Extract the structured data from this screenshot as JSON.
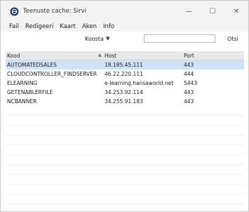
{
  "window": {
    "title": "Teenuste cache: Sirvi",
    "controls": {
      "minimize": "—",
      "maximize": "☐",
      "close": "✕"
    }
  },
  "menu": [
    "Fail",
    "Redigeeri",
    "Kaart",
    "Aken",
    "Info"
  ],
  "toolbar": {
    "sort_label": "Koosta",
    "sort_arrow": "▼",
    "search_value": "",
    "search_label": "Otsi"
  },
  "table": {
    "columns": [
      "Kood",
      "Host",
      "Port"
    ],
    "rows": [
      {
        "code": "AUTOMATEDSALES",
        "host": "18.185.45.111",
        "port": "443",
        "selected": true
      },
      {
        "code": "CLOUDCONTROLLER_FINDSERVER",
        "host": "46.22.220.111",
        "port": "444",
        "selected": false
      },
      {
        "code": "ELEARNING",
        "host": "e-learning.hansaworld.net",
        "port": "5443",
        "selected": false
      },
      {
        "code": "GETENABLERFILE",
        "host": "34.253.92.114",
        "port": "443",
        "selected": false
      },
      {
        "code": "NCBANNER",
        "host": "34.255.91.183",
        "port": "443",
        "selected": false
      }
    ]
  },
  "colors": {
    "selected_row": "#cfe2f7",
    "header_bg": "#e9e9e9"
  },
  "icons": {
    "app": "app-globe-icon",
    "sort": "sort-ascending-icon"
  }
}
